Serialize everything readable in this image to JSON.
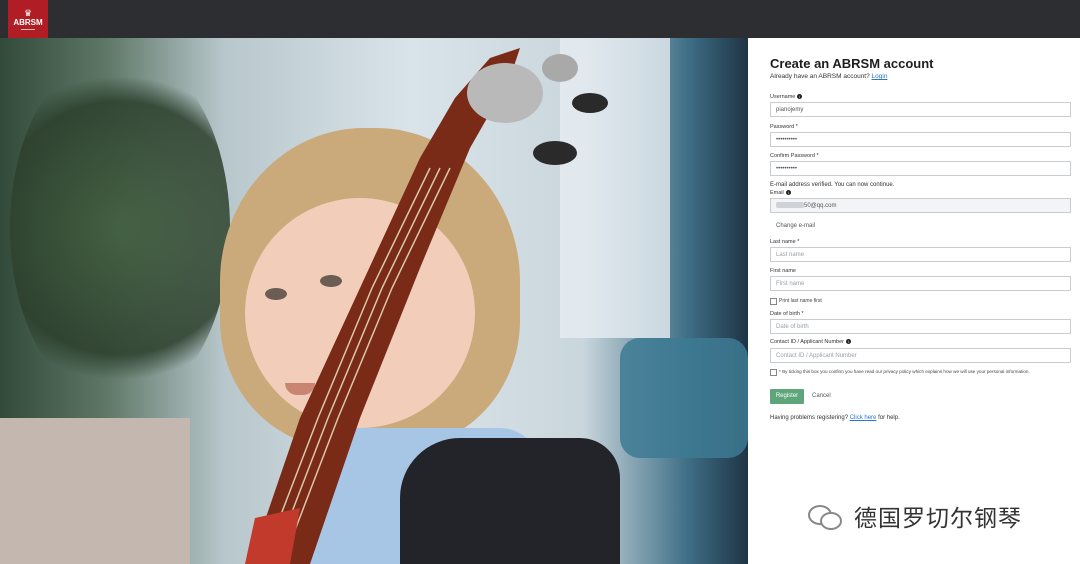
{
  "header": {
    "logo_text": "ABRSM"
  },
  "form": {
    "title": "Create an ABRSM account",
    "subtitle": "Already have an ABRSM account?",
    "login_link": "Login",
    "username": {
      "label": "Username",
      "value": "pianojemy"
    },
    "password": {
      "label": "Password *",
      "value": "••••••••••"
    },
    "confirm_password": {
      "label": "Confirm Password *",
      "value": "••••••••••"
    },
    "email_verified_note": "E-mail address verified. You can now continue.",
    "email": {
      "label": "Email",
      "value": "50@qq.com"
    },
    "change_email": "Change e-mail",
    "last_name": {
      "label": "Last name *",
      "placeholder": "Last name"
    },
    "first_name": {
      "label": "First name",
      "placeholder": "First name"
    },
    "print_last_name_first": "Print last name first",
    "date_of_birth": {
      "label": "Date of birth *",
      "placeholder": "Date of birth"
    },
    "contact_id": {
      "label": "Contact ID / Applicant Number",
      "placeholder": "Contact ID / Applicant Number"
    },
    "consent_text": "* By ticking this box you confirm you have read our privacy policy which explains how we will use your personal information.",
    "register_button": "Register",
    "cancel_button": "Cancel",
    "help_prefix": "Having problems registering?",
    "help_link": "Click here",
    "help_suffix": "for help."
  },
  "watermark": {
    "text": "德国罗切尔钢琴"
  },
  "colors": {
    "topbar": "#2d2e31",
    "brand_red": "#b01d24",
    "register_green": "#5fa57c",
    "link_blue": "#2a78c9"
  }
}
